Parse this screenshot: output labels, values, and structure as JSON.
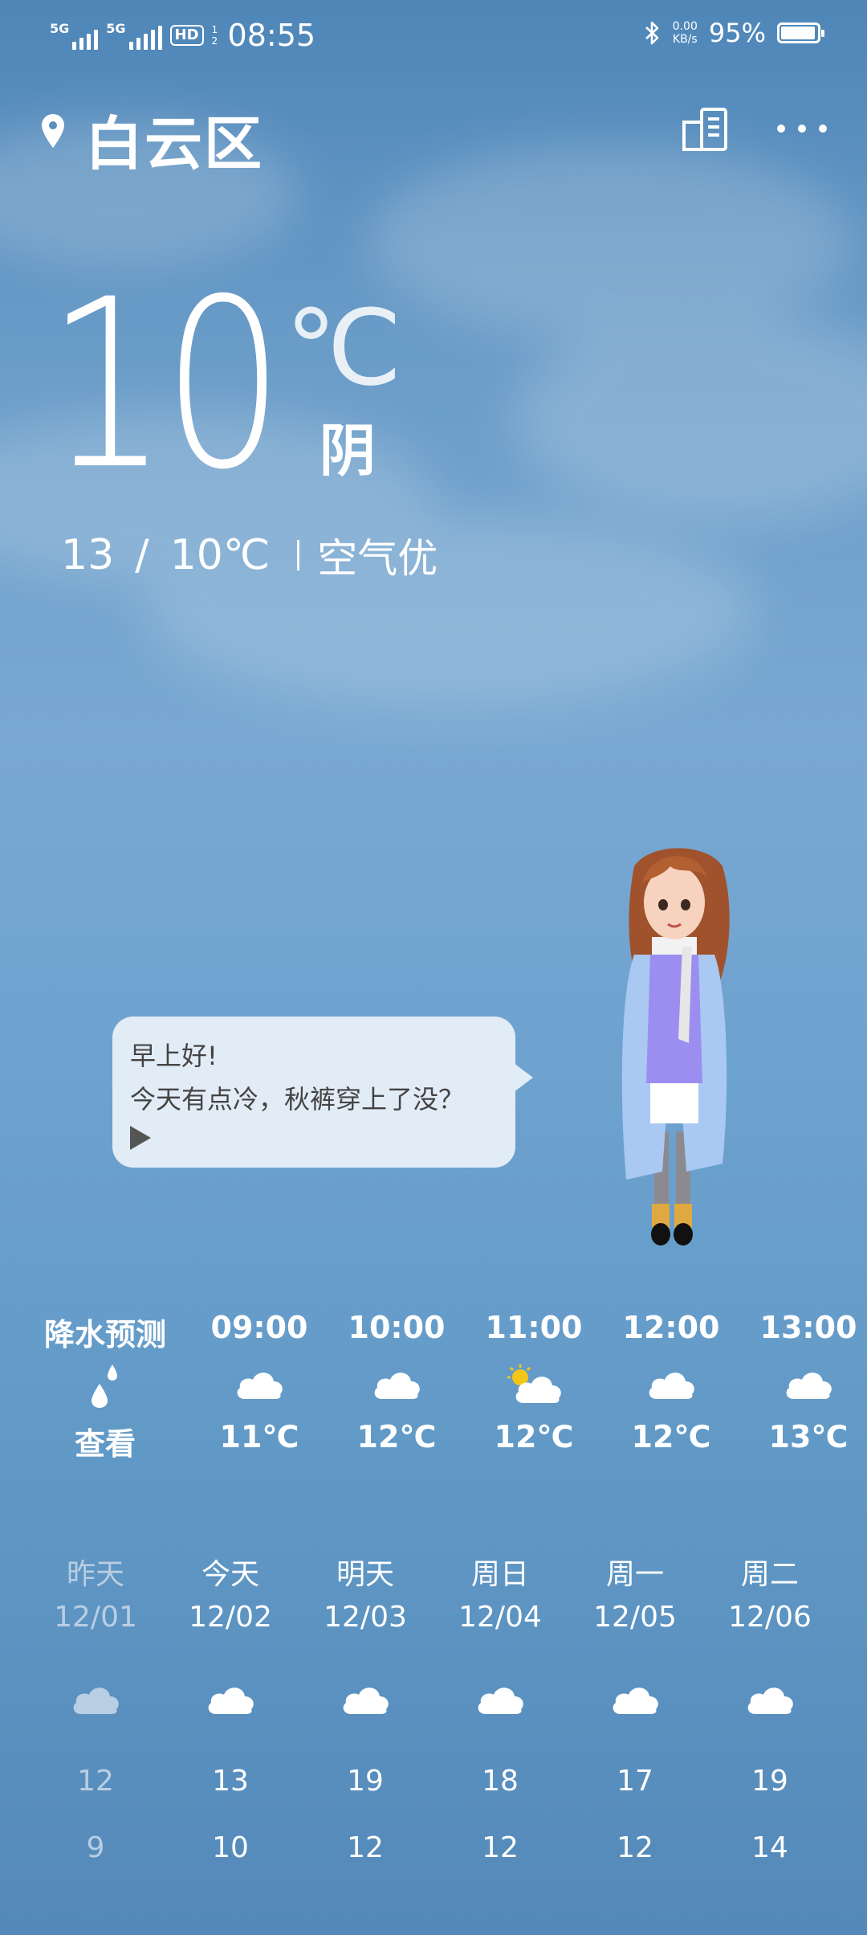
{
  "status_bar": {
    "signal_1": "5G",
    "signal_2": "5G",
    "hd": "HD",
    "hd_sub": "1 2",
    "time": "08:55",
    "net_speed_value": "0.00",
    "net_speed_unit": "KB/s",
    "battery": "95%",
    "battery_level": 0.95
  },
  "header": {
    "location": "白云区"
  },
  "current": {
    "temp": "10",
    "unit": "℃",
    "condition": "阴",
    "high": "13",
    "separator": "/",
    "low": "10℃",
    "air_quality": "空气优"
  },
  "assistant": {
    "greeting": "早上好!",
    "message": "今天有点冷，秋裤穿上了没？"
  },
  "hourly": {
    "precip_label": "降水预测",
    "precip_action": "查看",
    "hours": [
      {
        "time": "09:00",
        "temp": "11℃",
        "icon": "cloudy-icon"
      },
      {
        "time": "10:00",
        "temp": "12℃",
        "icon": "cloudy-icon"
      },
      {
        "time": "11:00",
        "temp": "12℃",
        "icon": "partly-sunny-icon"
      },
      {
        "time": "12:00",
        "temp": "12℃",
        "icon": "cloudy-icon"
      },
      {
        "time": "13:00",
        "temp": "13℃",
        "icon": "cloudy-icon"
      }
    ]
  },
  "daily": [
    {
      "day": "昨天",
      "date": "12/01",
      "high": "12",
      "low": "9",
      "icon": "cloudy-icon"
    },
    {
      "day": "今天",
      "date": "12/02",
      "high": "13",
      "low": "10",
      "icon": "cloudy-icon"
    },
    {
      "day": "明天",
      "date": "12/03",
      "high": "19",
      "low": "12",
      "icon": "cloudy-icon"
    },
    {
      "day": "周日",
      "date": "12/04",
      "high": "18",
      "low": "12",
      "icon": "cloudy-icon"
    },
    {
      "day": "周一",
      "date": "12/05",
      "high": "17",
      "low": "12",
      "icon": "cloudy-icon"
    },
    {
      "day": "周二",
      "date": "12/06",
      "high": "19",
      "low": "14",
      "icon": "cloudy-icon"
    }
  ],
  "colors": {
    "bg_top": "#4e86b8",
    "bg_bottom": "#5489b9",
    "bubble": "#e2ecf6",
    "dim_text": "#b9cee3",
    "sun": "#f5c518"
  }
}
